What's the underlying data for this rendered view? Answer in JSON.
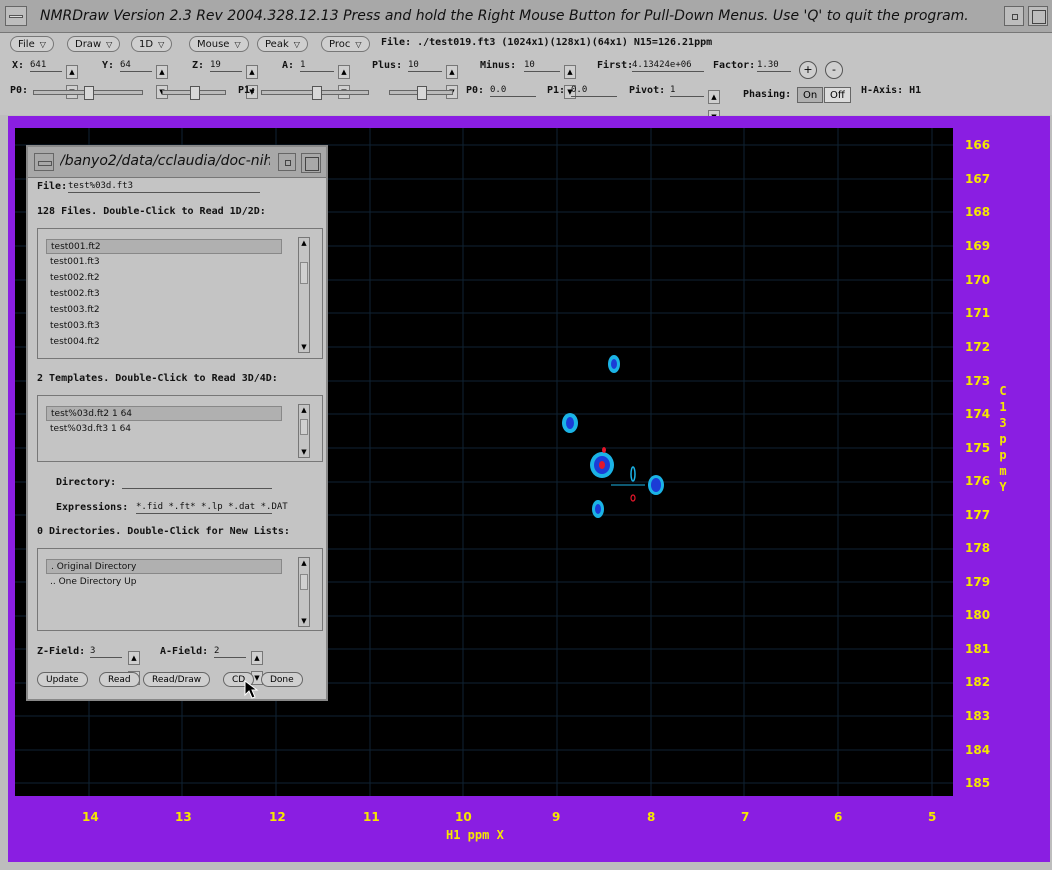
{
  "window": {
    "title": "NMRDraw Version 2.3 Rev 2004.328.12.13   Press and hold the Right Mouse Button for Pull-Down Menus.   Use 'Q' to quit the program."
  },
  "toolbar": {
    "menus": [
      "File",
      "Draw",
      "1D",
      "Mouse",
      "Peak",
      "Proc"
    ],
    "file_info": "File: ./test019.ft3 (1024x1)(128x1)(64x1) N15=126.21ppm",
    "x_label": "X:",
    "x_value": "641",
    "y_label": "Y:",
    "y_value": "64",
    "z_label": "Z:",
    "z_value": "19",
    "a_label": "A:",
    "a_value": "1",
    "plus_label": "Plus:",
    "plus_value": "10",
    "minus_label": "Minus:",
    "minus_value": "10",
    "first_label": "First:",
    "first_value": "4.13424e+06",
    "factor_label": "Factor:",
    "factor_value": "1.30",
    "plus_btn": "+",
    "minus_btn": "-",
    "p0_label": "P0:",
    "p1_label": "P1:",
    "p0_field_label": "P0:",
    "p0_field": "0.0",
    "p1_field_label": "P1:",
    "p1_field": "0.0",
    "pivot_label": "Pivot:",
    "pivot_value": "1",
    "phasing_label": "Phasing:",
    "phasing_on": "On",
    "phasing_off": "Off",
    "haxis": "H-Axis: H1",
    "spin_up": "▲",
    "spin_down": "▼"
  },
  "plot": {
    "y_ticks": [
      "166",
      "167",
      "168",
      "169",
      "170",
      "171",
      "172",
      "173",
      "174",
      "175",
      "176",
      "177",
      "178",
      "179",
      "180",
      "181",
      "182",
      "183",
      "184",
      "185"
    ],
    "x_ticks": [
      "14",
      "13",
      "12",
      "11",
      "10",
      "9",
      "8",
      "7",
      "6",
      "5"
    ],
    "y_axis_title": "C13 ppm Y",
    "x_axis_title": "H1 ppm X",
    "colors": {
      "frame": "#8a1ee2",
      "axis_text": "#f5e800",
      "background": "#000000",
      "grid": "#1a2a3a"
    }
  },
  "dialog": {
    "title": "/banyo2/data/cclaudia/doc-nih",
    "file_label": "File:",
    "file_value": "test%03d.ft3",
    "files_heading": "128 Files. Double-Click to Read 1D/2D:",
    "files": [
      "test001.ft2",
      "test001.ft3",
      "test002.ft2",
      "test002.ft3",
      "test003.ft2",
      "test003.ft3",
      "test004.ft2"
    ],
    "templates_heading": "2 Templates. Double-Click to Read 3D/4D:",
    "templates": [
      "test%03d.ft2 1 64",
      "test%03d.ft3 1 64"
    ],
    "directory_label": "Directory:",
    "directory_value": "",
    "expressions_label": "Expressions:",
    "expressions_value": "*.fid *.ft* *.lp *.dat *.DAT",
    "dirs_heading": "0 Directories. Double-Click for New Lists:",
    "dirs": [
      ".  Original Directory",
      "..  One Directory Up"
    ],
    "zfield_label": "Z-Field:",
    "zfield_value": "3",
    "afield_label": "A-Field:",
    "afield_value": "2",
    "buttons": [
      "Update",
      "Read",
      "Read/Draw",
      "CD",
      "Done"
    ]
  }
}
